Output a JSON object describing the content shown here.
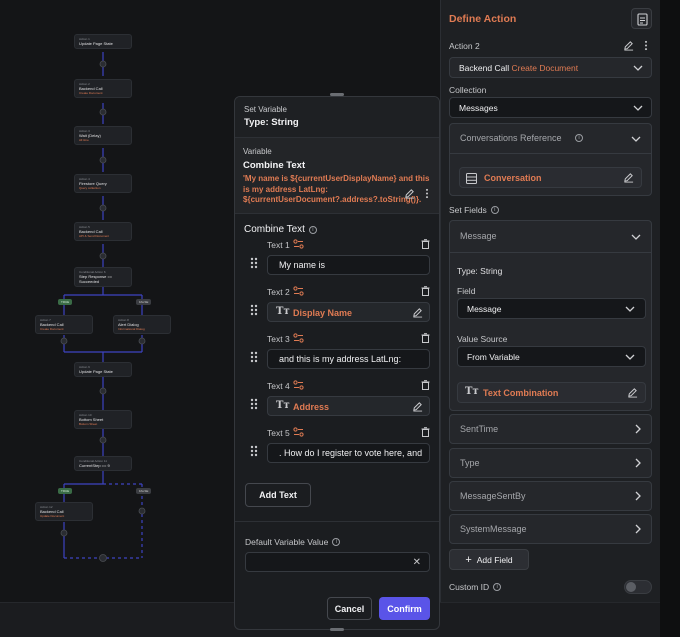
{
  "flow": {
    "nodes": [
      {
        "small": "Action 1",
        "title": "Update Page State",
        "sub": ""
      },
      {
        "small": "Action 2",
        "title": "Backend Call",
        "sub": "Create Document"
      },
      {
        "small": "Action 3",
        "title": "Wait (Delay)",
        "sub": "All time"
      },
      {
        "small": "Action 4",
        "title": "Firestore Query",
        "sub": "Query collection"
      },
      {
        "small": "Action 5",
        "title": "Backend Call",
        "sub": "API & Send Document"
      },
      {
        "small": "Conditional Action 6",
        "title": "Step Response == Succeeded",
        "sub": ""
      },
      {
        "small": "Action 7",
        "title": "Backend Call",
        "sub": "Create Document"
      },
      {
        "small": "Action 8",
        "title": "Alert Dialog",
        "sub": "Informational Dialog"
      },
      {
        "small": "Action 9",
        "title": "Update Page State",
        "sub": ""
      },
      {
        "small": "Action 10",
        "title": "Bottom Sheet",
        "sub": "Bottom Sheet"
      },
      {
        "small": "Conditional Action 11",
        "title": "CurrentStep == 9",
        "sub": ""
      },
      {
        "small": "Action 12",
        "title": "Backend Call",
        "sub": "Update Document"
      }
    ],
    "tags": {
      "true": "TRUE",
      "false": "FALSE"
    }
  },
  "modal": {
    "header_small": "Set Variable",
    "header_type": "Type: String",
    "variable_label": "Variable",
    "variable_name": "Combine Text",
    "variable_expr": "'My name is ${currentUserDisplayName} and this is my address LatLng: ${currentUserDocument?.address?.toString()}. Ho...",
    "combine_title": "Combine Text",
    "texts": [
      {
        "label": "Text 1",
        "value": "My name is",
        "chip": false
      },
      {
        "label": "Text 2",
        "value": "Display Name",
        "chip": true
      },
      {
        "label": "Text 3",
        "value": "and this is my address LatLng:",
        "chip": false
      },
      {
        "label": "Text 4",
        "value": "Address",
        "chip": true
      },
      {
        "label": "Text 5",
        "value": ". How do I register to vote here, and",
        "chip": false
      }
    ],
    "add_text_label": "Add Text",
    "default_label": "Default Variable Value",
    "cancel_label": "Cancel",
    "confirm_label": "Confirm"
  },
  "panel": {
    "title": "Define Action",
    "action_label": "Action 2",
    "backend_call": "Backend Call",
    "backend_call_type": "Create Document",
    "collection_label": "Collection",
    "collection_value": "Messages",
    "conv_ref_label": "Conversations Reference",
    "conversation_value": "Conversation",
    "set_fields_label": "Set Fields",
    "message_header": "Message",
    "message_type": "Type: String",
    "field_label": "Field",
    "field_value": "Message",
    "value_source_label": "Value Source",
    "value_source_value": "From Variable",
    "text_combination": "Text Combination",
    "other_fields": [
      "SentTime",
      "Type",
      "MessageSentBy",
      "SystemMessage"
    ],
    "add_field_label": "Add Field",
    "custom_id_label": "Custom ID"
  },
  "colors": {
    "accent": "#e07b53",
    "primary_button": "#5a54e8",
    "background": "#131416",
    "panel": "#1e2023"
  }
}
